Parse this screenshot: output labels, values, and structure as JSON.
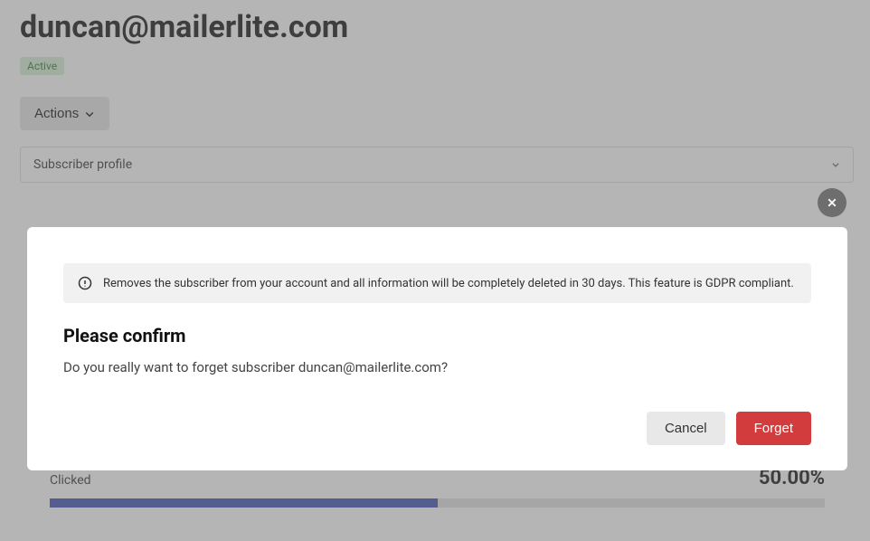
{
  "header": {
    "email": "duncan@mailerlite.com",
    "status": "Active",
    "actions_label": "Actions",
    "profile_selector": "Subscriber profile"
  },
  "stats": {
    "clicked_label": "Clicked",
    "clicked_value": "50.00%",
    "clicked_fill_percent": 50
  },
  "modal": {
    "info_text": "Removes the subscriber from your account and all information will be completely deleted in 30 days. This feature is GDPR compliant.",
    "title": "Please confirm",
    "body": "Do you really want to forget subscriber duncan@mailerlite.com?",
    "cancel_label": "Cancel",
    "forget_label": "Forget"
  }
}
